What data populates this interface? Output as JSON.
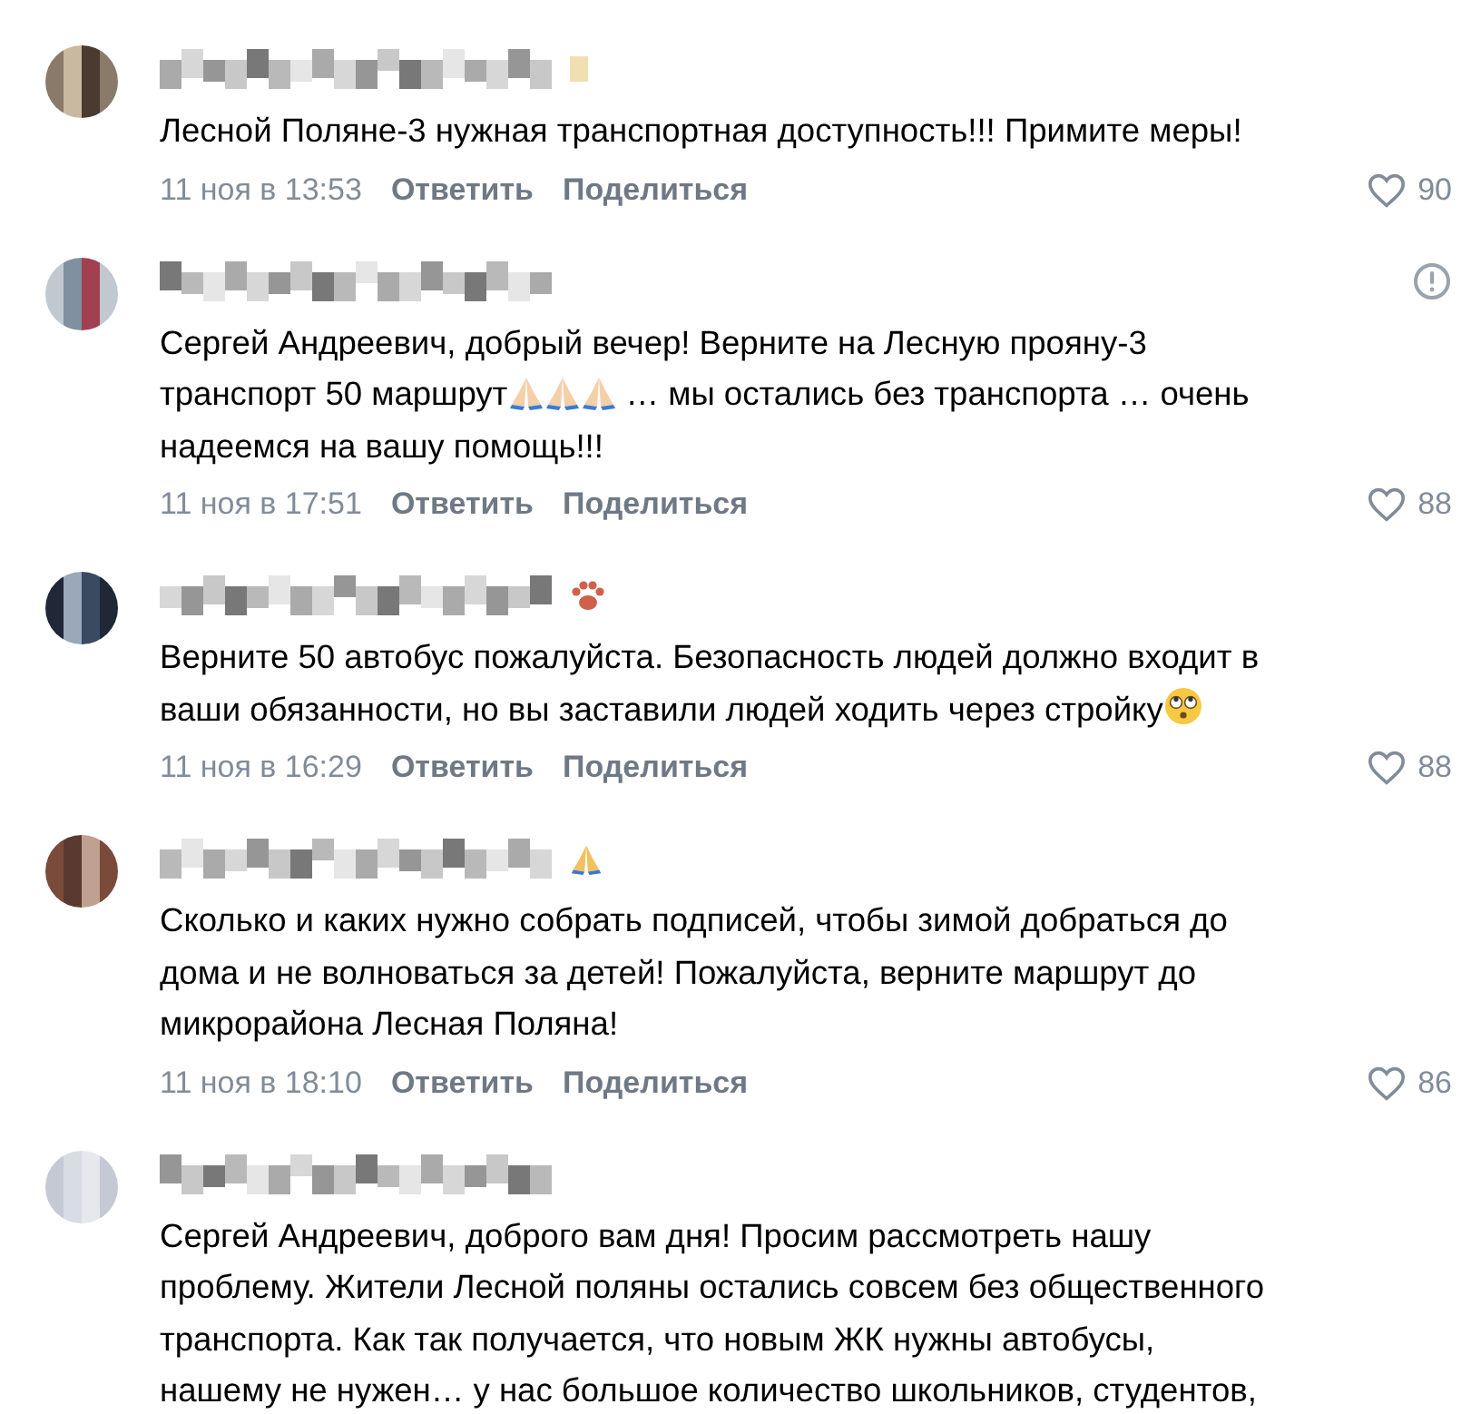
{
  "comments": [
    {
      "name_badge": {
        "kind": "square"
      },
      "report": false,
      "lines": [
        [
          {
            "kind": "text",
            "text": "Лесной Поляне-3 нужная транспортная доступность!!! Примите меры!"
          }
        ]
      ],
      "date": "11 ноя в 13:53",
      "reply": "Ответить",
      "share": "Поделиться",
      "likes": "90"
    },
    {
      "report": true,
      "lines": [
        [
          {
            "kind": "text",
            "text": "Сергей Андреевич, добрый вечер! Верните на Лесную прояну-3"
          }
        ],
        [
          {
            "kind": "text",
            "text": "транспорт 50 маршрут"
          },
          {
            "kind": "pray"
          },
          {
            "kind": "pray"
          },
          {
            "kind": "pray"
          },
          {
            "kind": "text",
            "text": " … мы остались без транспорта … очень"
          }
        ],
        [
          {
            "kind": "text",
            "text": "надеемся на вашу помощь!!!"
          }
        ]
      ],
      "date": "11 ноя в 17:51",
      "reply": "Ответить",
      "share": "Поделиться",
      "likes": "88"
    },
    {
      "name_badge": {
        "kind": "paw"
      },
      "report": false,
      "lines": [
        [
          {
            "kind": "text",
            "text": "Верните 50 автобус пожалуйста. Безопасность людей должно входит в"
          }
        ],
        [
          {
            "kind": "text",
            "text": "ваши обязанности, но вы заставили людей ходить через стройку"
          },
          {
            "kind": "eyes"
          }
        ]
      ],
      "date": "11 ноя в 16:29",
      "reply": "Ответить",
      "share": "Поделиться",
      "likes": "88"
    },
    {
      "name_badge": {
        "kind": "pray"
      },
      "report": false,
      "lines": [
        [
          {
            "kind": "text",
            "text": "Сколько и каких нужно собрать подписей, чтобы зимой добраться до"
          }
        ],
        [
          {
            "kind": "text",
            "text": "дома и не волноваться за детей! Пожалуйста, верните маршрут до"
          }
        ],
        [
          {
            "kind": "text",
            "text": "микрорайона Лесная Поляна!"
          }
        ]
      ],
      "date": "11 ноя в 18:10",
      "reply": "Ответить",
      "share": "Поделиться",
      "likes": "86"
    },
    {
      "report": false,
      "lines": [
        [
          {
            "kind": "text",
            "text": "Сергей Андреевич, доброго вам дня! Просим рассмотреть нашу"
          }
        ],
        [
          {
            "kind": "text",
            "text": "проблему. Жители Лесной поляны остались совсем без общественного"
          }
        ],
        [
          {
            "kind": "text",
            "text": "транспорта. Как так получается, что новым ЖК нужны автобусы,"
          }
        ],
        [
          {
            "kind": "text",
            "text": "нашему не нужен… у нас большое количество школьников, студентов,"
          }
        ]
      ]
    }
  ]
}
